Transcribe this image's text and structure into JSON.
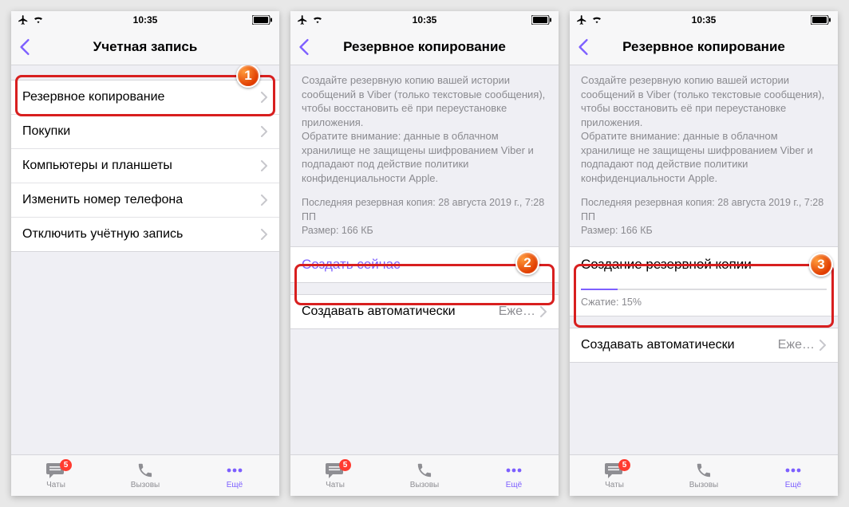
{
  "status": {
    "time": "10:35"
  },
  "badges": {
    "chats": "5"
  },
  "tabs": {
    "chats": "Чаты",
    "calls": "Вызовы",
    "more": "Ещё"
  },
  "steps": {
    "s1": "1",
    "s2": "2",
    "s3": "3"
  },
  "screen1": {
    "title": "Учетная запись",
    "items": {
      "i0": "Резервное копирование",
      "i1": "Покупки",
      "i2": "Компьютеры и планшеты",
      "i3": "Изменить номер телефона",
      "i4": "Отключить учётную запись"
    }
  },
  "screen2": {
    "title": "Резервное копирование",
    "desc": "Создайте резервную копию вашей истории сообщений в Viber (только текстовые сообщения), чтобы восстановить её при переустановке приложения.\nОбратите внимание: данные в облачном хранилище не защищены шифрованием Viber и подпадают под действие политики конфиденциальности Apple.",
    "last_backup": "Последняя резервная копия: 28 августа 2019 г., 7:28 ПП",
    "size": "Размер: 166 КБ",
    "create_now": "Создать сейчас",
    "auto_label": "Создавать автоматически",
    "auto_value": "Еже…"
  },
  "screen3": {
    "title": "Резервное копирование",
    "desc": "Создайте резервную копию вашей истории сообщений в Viber (только текстовые сообщения), чтобы восстановить её при переустановке приложения.\nОбратите внимание: данные в облачном хранилище не защищены шифрованием Viber и подпадают под действие политики конфиденциальности Apple.",
    "last_backup": "Последняя резервная копия: 28 августа 2019 г., 7:28 ПП",
    "size": "Размер: 166 КБ",
    "creating_title": "Создание резервной копии",
    "progress_label": "Сжатие: 15%",
    "progress_pct": 15,
    "auto_label": "Создавать автоматически",
    "auto_value": "Еже…"
  }
}
